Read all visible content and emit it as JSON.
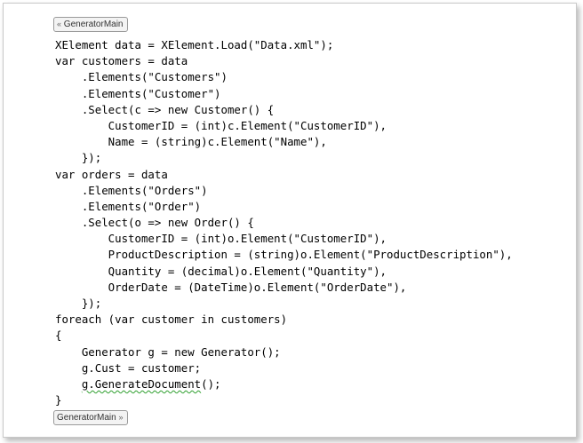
{
  "tags": {
    "open": "GeneratorMain",
    "close": "GeneratorMain"
  },
  "icons": {
    "open_arrow": "double-chevron-left-icon",
    "close_arrow": "double-chevron-right-icon"
  },
  "colors": {
    "squiggle": "#2e9e2e"
  },
  "code_lines": [
    [
      {
        "t": "XElement data = XElement.Load(\"Data.xml\");"
      }
    ],
    [
      {
        "t": "var customers = data"
      }
    ],
    [
      {
        "t": "    .Elements(\"Customers\")"
      }
    ],
    [
      {
        "t": "    .Elements(\"Customer\")"
      }
    ],
    [
      {
        "t": "    .Select(c => new Customer() {"
      }
    ],
    [
      {
        "t": "        CustomerID = (int)c.Element(\"CustomerID\"),"
      }
    ],
    [
      {
        "t": "        Name = (string)c.Element(\"Name\"),"
      }
    ],
    [
      {
        "t": "    });"
      }
    ],
    [
      {
        "t": "var orders = data"
      }
    ],
    [
      {
        "t": "    .Elements(\"Orders\")"
      }
    ],
    [
      {
        "t": "    .Elements(\"Order\")"
      }
    ],
    [
      {
        "t": "    .Select(o => new Order() {"
      }
    ],
    [
      {
        "t": "        CustomerID = (int)o.Element(\"CustomerID\"),"
      }
    ],
    [
      {
        "t": "        ProductDescription = (string)o.Element(\"ProductDescription\"),"
      }
    ],
    [
      {
        "t": "        Quantity = (decimal)o.Element(\"Quantity\"),"
      }
    ],
    [
      {
        "t": "        OrderDate = (DateTime)o.Element(\"OrderDate\"),"
      }
    ],
    [
      {
        "t": "    });"
      }
    ],
    [
      {
        "t": "foreach (var customer in customers)"
      }
    ],
    [
      {
        "t": "{"
      }
    ],
    [
      {
        "t": "    Generator g = new Generator();"
      }
    ],
    [
      {
        "t": "    g.Cust = customer;"
      }
    ],
    [
      {
        "t": "    "
      },
      {
        "t": "g.GenerateDocument",
        "err": true
      },
      {
        "t": "();"
      }
    ],
    [
      {
        "t": "}"
      }
    ]
  ]
}
